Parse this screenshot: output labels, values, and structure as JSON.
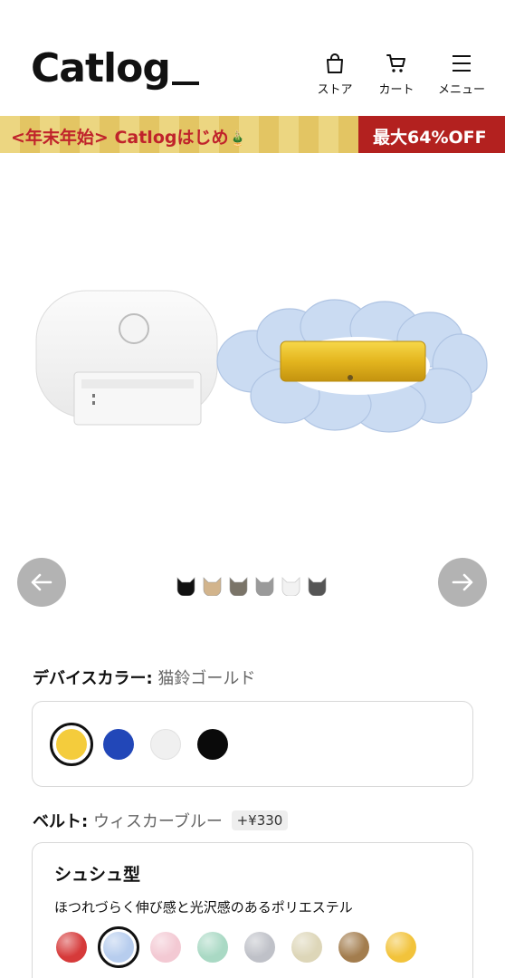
{
  "header": {
    "logo": "Catlog",
    "nav": [
      {
        "label": "ストア",
        "icon": "shopping-bag-icon"
      },
      {
        "label": "カート",
        "icon": "cart-icon"
      },
      {
        "label": "メニュー",
        "icon": "hamburger-menu-icon"
      }
    ]
  },
  "promo": {
    "text": "<年末年始> Catlogはじめ",
    "emoji": "🎍",
    "sale": "最大64%OFF",
    "colors": {
      "left_bg": "#e8cf74",
      "text": "#c0232b",
      "right_bg": "#b3211f"
    }
  },
  "gallery": {
    "prev_icon": "arrow-left-icon",
    "next_icon": "arrow-right-icon",
    "dot_colors": [
      "#111111",
      "#d2b48c",
      "#7a7468",
      "#9a9a9a",
      "#f2f2f2",
      "#555555"
    ]
  },
  "device_color": {
    "label": "デバイスカラー:",
    "value": "猫鈴ゴールド",
    "swatches": [
      {
        "color": "#f4cc3c",
        "selected": true
      },
      {
        "color": "#2247b8",
        "selected": false
      },
      {
        "color": "#f0f0f0",
        "selected": false
      },
      {
        "color": "#0a0a0a",
        "selected": false
      }
    ]
  },
  "belt": {
    "label": "ベルト:",
    "value": "ウィスカーブルー",
    "price": "+¥330",
    "type_title": "シュシュ型",
    "type_desc": "ほつれづらく伸び感と光沢感のあるポリエステル",
    "swatches": [
      {
        "color": "#d63a3a",
        "selected": false
      },
      {
        "color": "#b7cdee",
        "selected": true
      },
      {
        "color": "#f3c9d3",
        "selected": false
      },
      {
        "color": "#a9d9c4",
        "selected": false
      },
      {
        "color": "#bfc1c8",
        "selected": false
      },
      {
        "color": "#ddd6b8",
        "selected": false
      },
      {
        "color": "#a37d4e",
        "selected": false
      },
      {
        "color": "#f2c33b",
        "selected": false
      }
    ]
  }
}
